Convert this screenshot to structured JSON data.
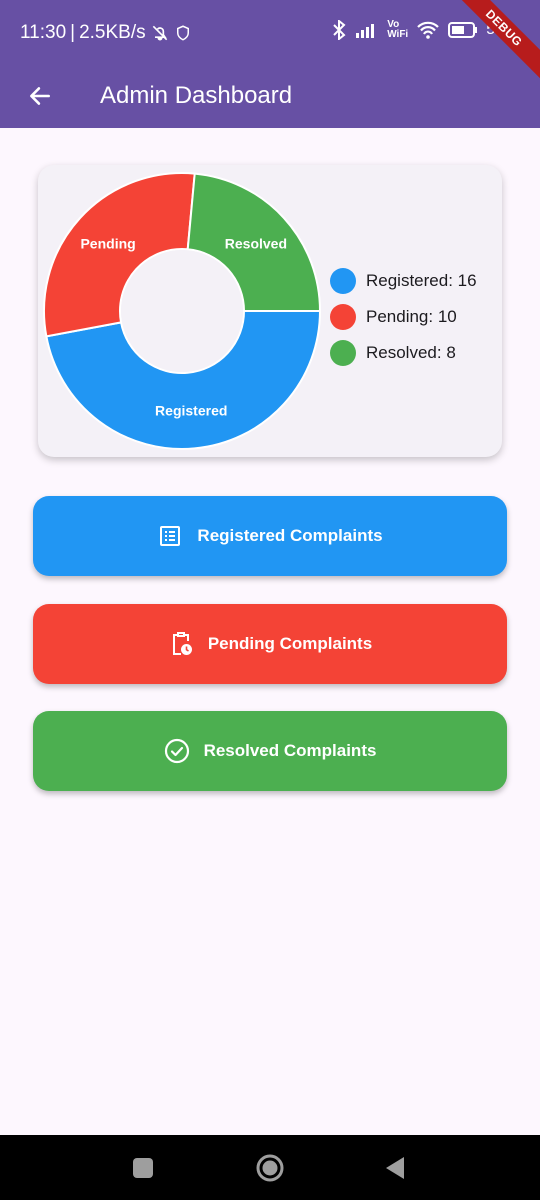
{
  "status_bar": {
    "time": "11:30",
    "network_speed": "2.5KB/s",
    "battery_level": "53",
    "debug_label": "DEBUG"
  },
  "app_bar": {
    "title": "Admin Dashboard",
    "back_icon": "arrow-back-icon",
    "color": "#6750a4"
  },
  "chart_data": {
    "type": "pie",
    "categories": [
      "Registered",
      "Pending",
      "Resolved"
    ],
    "values": [
      16,
      10,
      8
    ],
    "colors": [
      "#2196f3",
      "#f44336",
      "#4caf50"
    ],
    "legend": [
      {
        "label": "Registered: 16",
        "color": "#2196f3"
      },
      {
        "label": "Pending: 10",
        "color": "#f44336"
      },
      {
        "label": "Resolved: 8",
        "color": "#4caf50"
      }
    ],
    "style": "donut",
    "legend_position": "right"
  },
  "buttons": [
    {
      "label": "Registered Complaints",
      "icon": "list-alt-icon",
      "color": "#2196f3"
    },
    {
      "label": "Pending Complaints",
      "icon": "pending-actions-icon",
      "color": "#f44336"
    },
    {
      "label": "Resolved Complaints",
      "icon": "check-circle-icon",
      "color": "#4caf50"
    }
  ],
  "nav_bar": {
    "items": [
      "recent-apps-icon",
      "home-icon",
      "back-icon"
    ]
  }
}
